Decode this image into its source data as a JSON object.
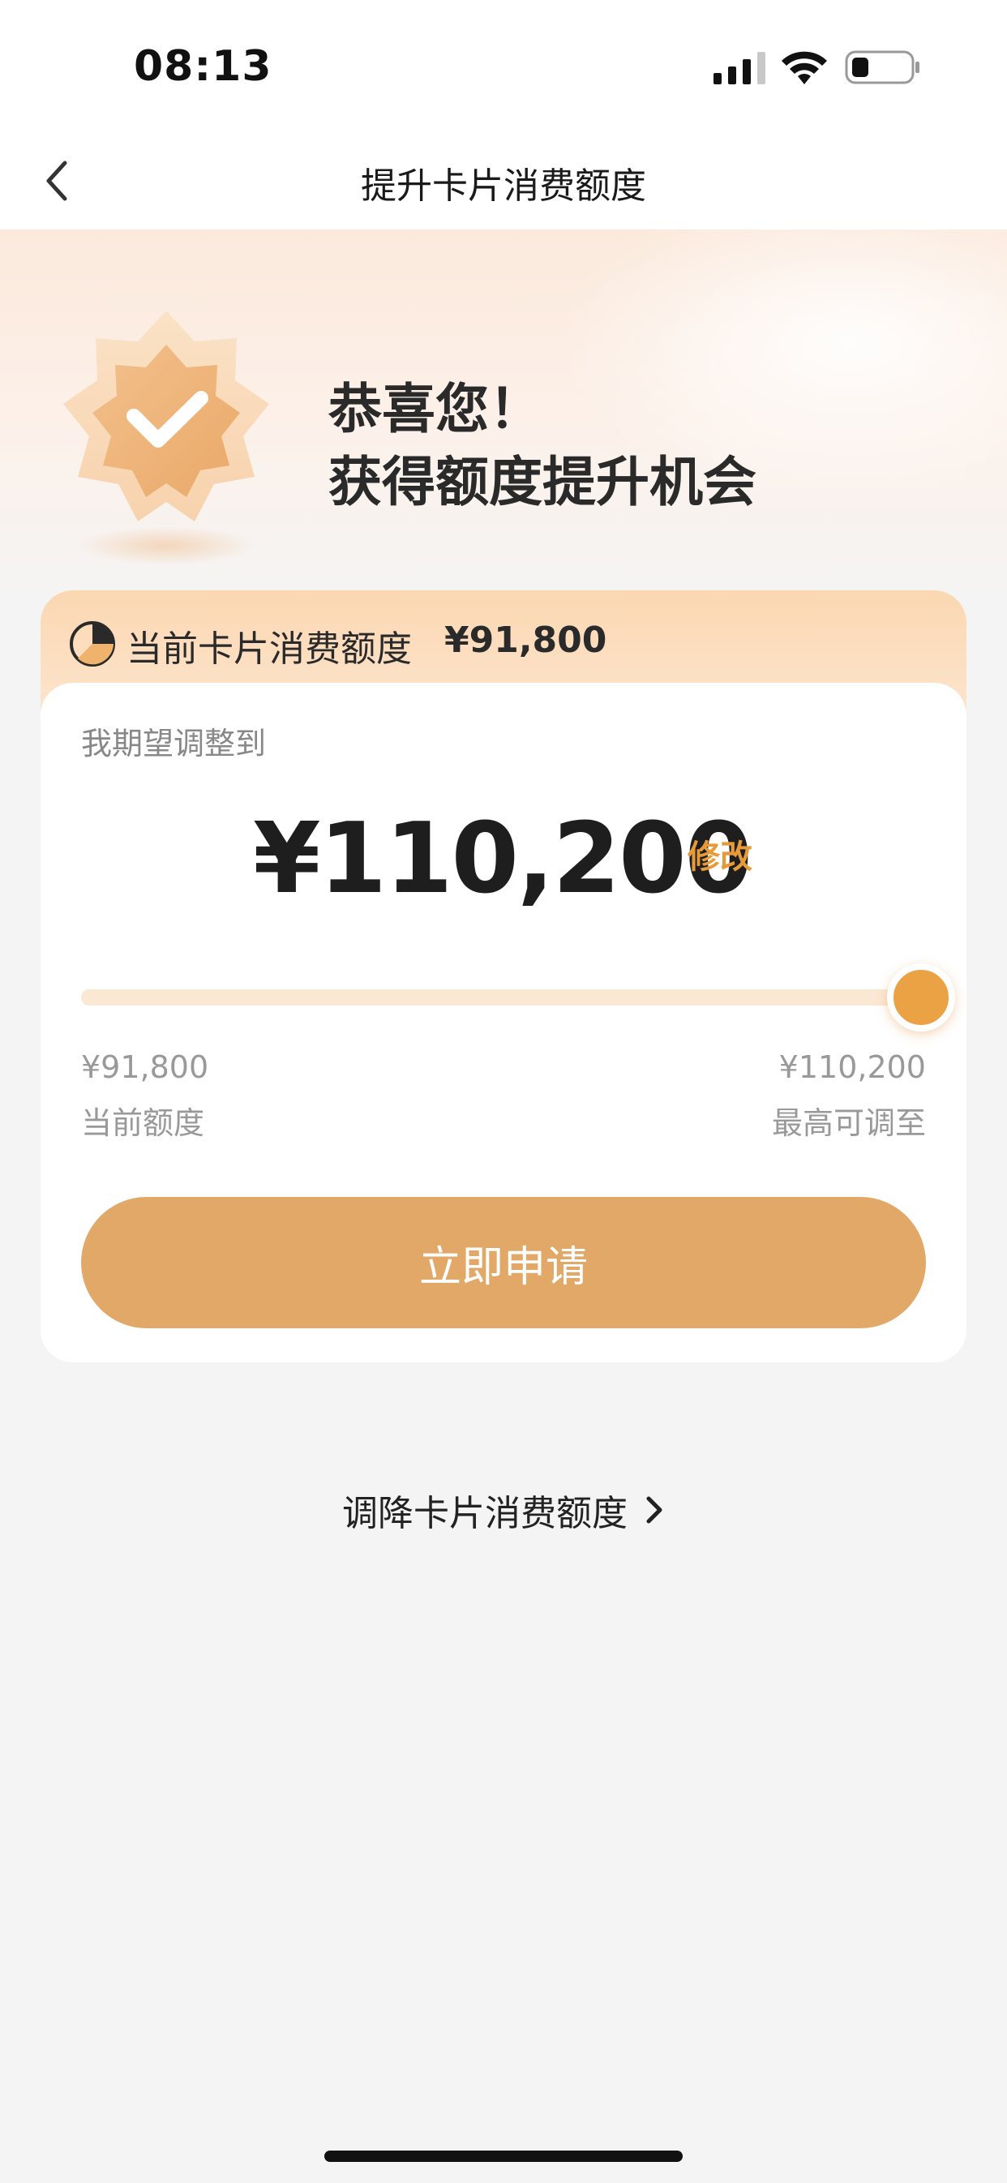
{
  "status_bar": {
    "time": "08:13",
    "signal_icon": "cellular-signal-icon",
    "wifi_icon": "wifi-icon",
    "battery_icon": "battery-low-icon"
  },
  "nav": {
    "back_icon": "chevron-left-icon",
    "title": "提升卡片消费额度"
  },
  "hero": {
    "badge_icon": "check-badge-icon",
    "line1": "恭喜您！",
    "line2": "获得额度提升机会"
  },
  "card": {
    "header_icon": "pie-chart-icon",
    "current_label": "当前卡片消费额度",
    "current_value": "¥91,800",
    "expect_label": "我期望调整到",
    "target_amount": "¥110,200",
    "modify_label": "修改",
    "slider": {
      "fraction": 1.0,
      "min_value": "¥91,800",
      "min_label": "当前额度",
      "max_value": "¥110,200",
      "max_label": "最高可调至"
    },
    "apply_label": "立即申请"
  },
  "reduce": {
    "label": "调降卡片消费额度",
    "icon": "chevron-right-icon"
  },
  "colors": {
    "accent": "#e69a3a",
    "button": "#e1a867",
    "slider_track": "#fbe8d4",
    "slider_thumb": "#eba245"
  }
}
